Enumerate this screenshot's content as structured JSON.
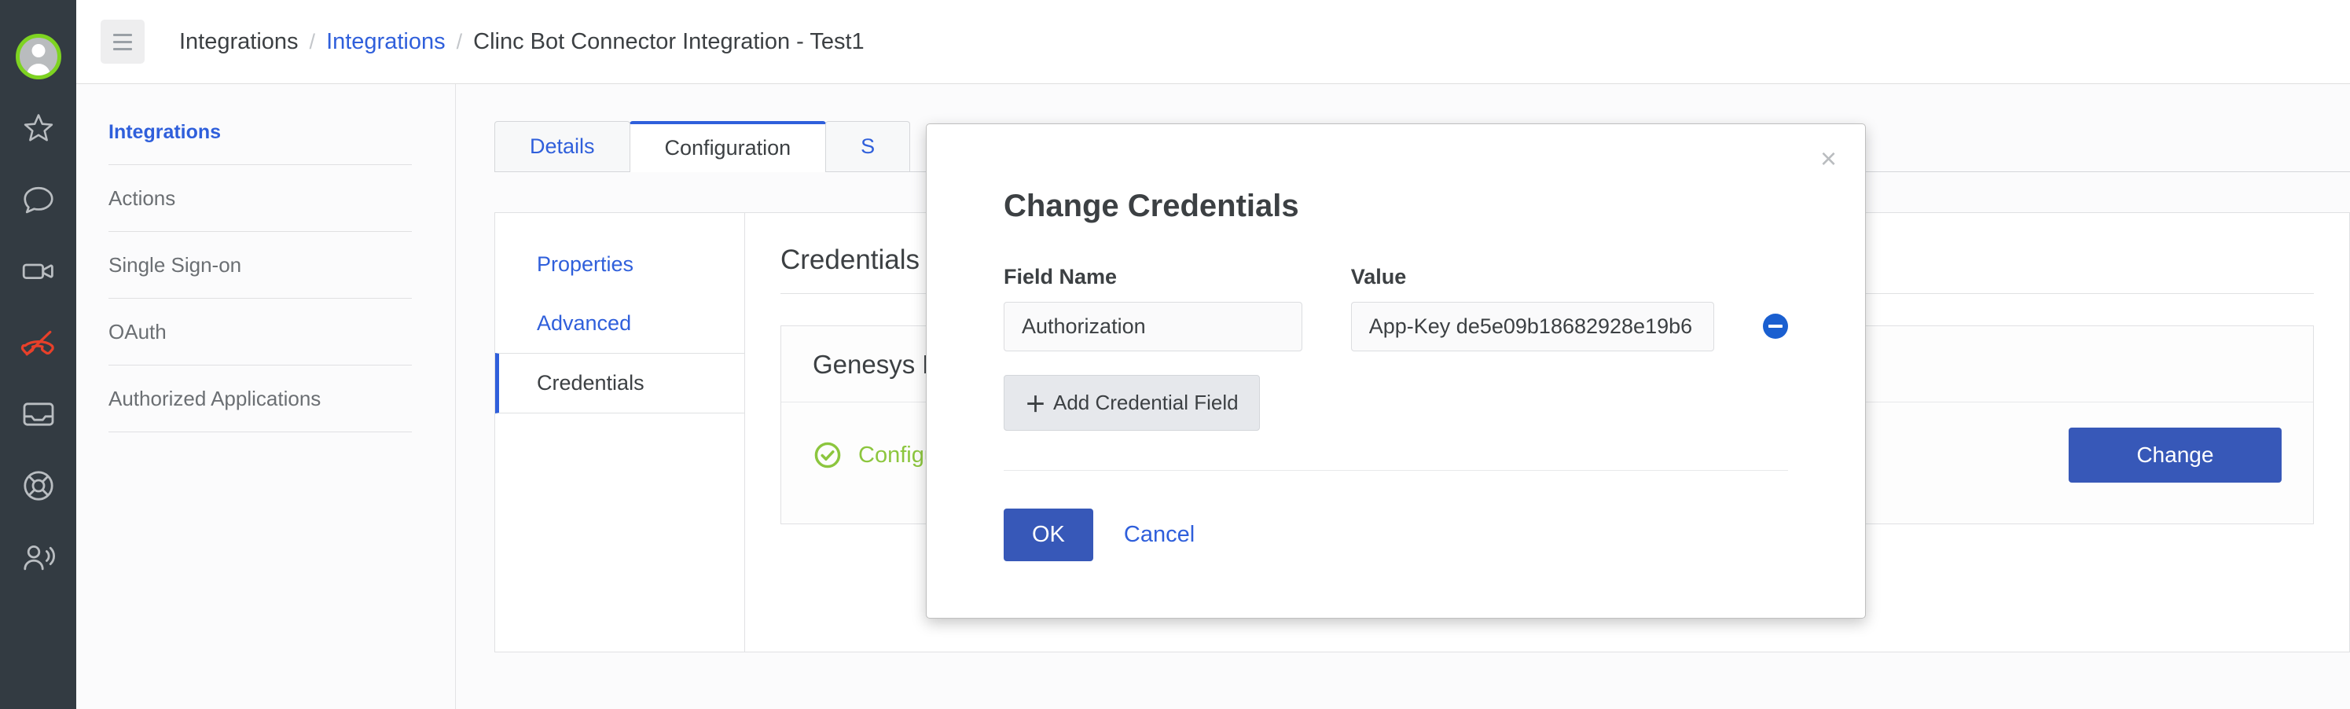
{
  "colors": {
    "rail_bg": "#333b42",
    "accent_blue": "#2f5fdb",
    "primary_button": "#3758b8",
    "success_green": "#8cc63e",
    "avatar_ring": "#7ed321",
    "danger_red": "#e8402a"
  },
  "rail": {
    "items": [
      {
        "icon": "user-avatar-icon",
        "label": "Avatar"
      },
      {
        "icon": "star-icon",
        "label": "Favorites"
      },
      {
        "icon": "chat-bubble-icon",
        "label": "Chat"
      },
      {
        "icon": "video-camera-icon",
        "label": "Video"
      },
      {
        "icon": "call-end-icon",
        "label": "End Call"
      },
      {
        "icon": "inbox-icon",
        "label": "Inbox"
      },
      {
        "icon": "lifesaver-icon",
        "label": "Support"
      },
      {
        "icon": "person-broadcast-icon",
        "label": "Directory"
      }
    ]
  },
  "header": {
    "menu_icon": "hamburger-icon",
    "breadcrumb": [
      {
        "label": "Integrations",
        "link": false
      },
      {
        "label": "Integrations",
        "link": true
      },
      {
        "label": "Clinc Bot Connector Integration - Test1",
        "link": false
      }
    ],
    "separator": "/"
  },
  "sidebar": {
    "heading": "Integrations",
    "items": [
      {
        "label": "Actions"
      },
      {
        "label": "Single Sign-on"
      },
      {
        "label": "OAuth"
      },
      {
        "label": "Authorized Applications"
      }
    ]
  },
  "main": {
    "tabs": [
      {
        "label": "Details",
        "active": false
      },
      {
        "label": "Configuration",
        "active": true
      },
      {
        "label": "S",
        "active": false
      }
    ],
    "subnav": [
      {
        "label": "Properties",
        "active": false
      },
      {
        "label": "Advanced",
        "active": false
      },
      {
        "label": "Credentials",
        "active": true
      }
    ],
    "panel_title": "Credentials",
    "credential_card": {
      "title": "Genesys Bot",
      "status_icon": "check-circle-icon",
      "status_label": "Configured",
      "change_label": "Change"
    }
  },
  "modal": {
    "title": "Change Credentials",
    "close_icon": "close-icon",
    "close_glyph": "×",
    "labels": {
      "field_name": "Field Name",
      "value": "Value"
    },
    "rows": [
      {
        "field_name": "Authorization",
        "field_name_placeholder": "Field Name",
        "value": "App-Key de5e09b18682928e19b6",
        "value_placeholder": "Value",
        "remove_icon": "remove-circle-icon"
      }
    ],
    "add_button": {
      "glyph": "＋",
      "label": "Add Credential Field",
      "icon": "plus-icon"
    },
    "ok_label": "OK",
    "cancel_label": "Cancel"
  }
}
